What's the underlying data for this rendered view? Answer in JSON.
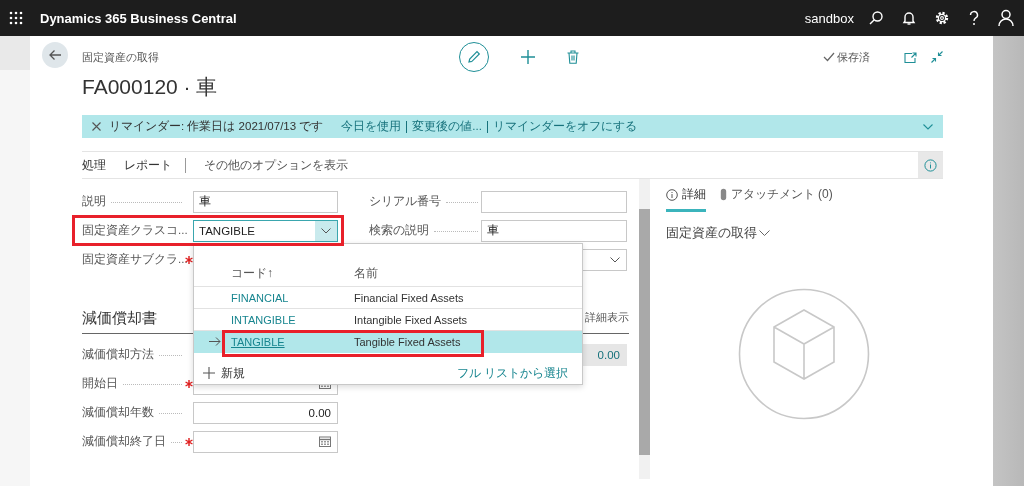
{
  "top_bar": {
    "app_title": "Dynamics 365 Business Central",
    "environment": "sandbox"
  },
  "header": {
    "breadcrumb": "固定資産の取得",
    "title": "FA000120 · 車",
    "save_status": "保存済"
  },
  "reminder": {
    "message": "リマインダー: 作業日は 2021/07/13 です",
    "actions": [
      "今日を使用",
      "変更後の値...",
      "リマインダーをオフにする"
    ]
  },
  "action_bar": {
    "actions": [
      "処理",
      "レポート"
    ],
    "more_options": "その他のオプションを表示"
  },
  "general": {
    "left": [
      {
        "label": "説明",
        "kind": "text",
        "value": "車"
      },
      {
        "label": "固定資産クラスコ...",
        "kind": "select",
        "value": "TANGIBLE",
        "focused": true,
        "highlighted": true
      },
      {
        "label": "固定資産サブクラ...",
        "required": true
      }
    ],
    "right": [
      {
        "label": "シリアル番号",
        "kind": "text"
      },
      {
        "label": "検索の説明",
        "kind": "text",
        "value": "車"
      },
      {
        "kind": "select"
      }
    ]
  },
  "depreciation": {
    "title": "減価償却書",
    "show_more": "詳細表示",
    "left": [
      {
        "label": "減価償却方法"
      },
      {
        "label": "開始日",
        "kind": "date",
        "required": true
      },
      {
        "label": "減価償却年数",
        "kind": "number",
        "value": "0.00"
      },
      {
        "label": "減価償却終了日",
        "kind": "date",
        "required": true
      }
    ],
    "right": [
      {
        "kind": "readonly",
        "value": "0.00"
      }
    ]
  },
  "lookup": {
    "columns": [
      "コード↑",
      "名前"
    ],
    "rows": [
      {
        "code": "FINANCIAL",
        "name": "Financial Fixed Assets",
        "selected": false
      },
      {
        "code": "INTANGIBLE",
        "name": "Intangible Fixed Assets",
        "selected": false
      },
      {
        "code": "TANGIBLE",
        "name": "Tangible Fixed Assets",
        "selected": true,
        "highlighted": true
      }
    ],
    "new_label": "新規",
    "full_list": "フル リストから選択"
  },
  "factbox": {
    "tabs": [
      {
        "label": "詳細",
        "selected": true
      },
      {
        "label": "アタッチメント (0)",
        "selected": false
      }
    ],
    "section": "固定資産の取得"
  }
}
